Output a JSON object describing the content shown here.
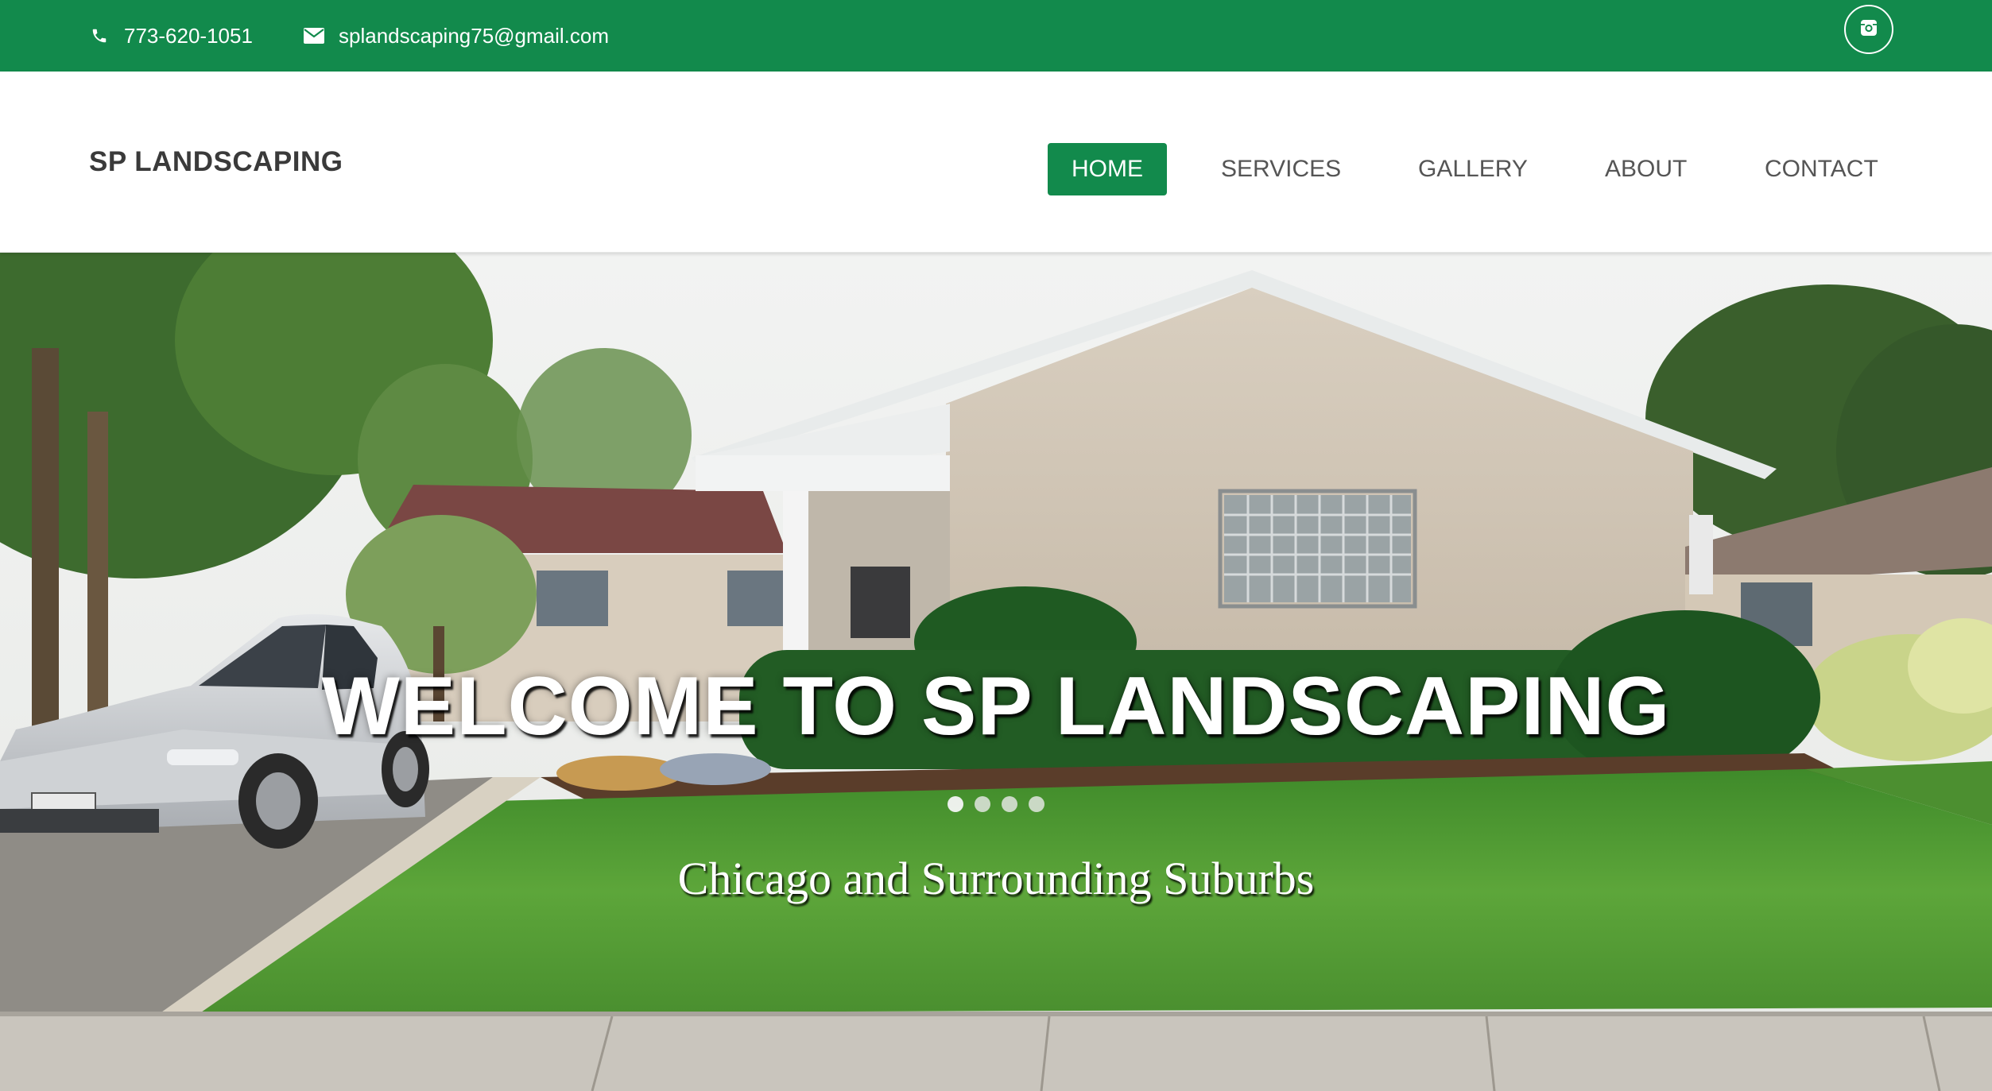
{
  "topbar": {
    "phone": "773-620-1051",
    "email": "splandscaping75@gmail.com",
    "social_icon": "instagram-icon",
    "background_color": "#128a4c"
  },
  "header": {
    "brand": "SP LANDSCAPING",
    "nav": [
      {
        "label": "HOME",
        "active": true
      },
      {
        "label": "SERVICES",
        "active": false
      },
      {
        "label": "GALLERY",
        "active": false
      },
      {
        "label": "ABOUT",
        "active": false
      },
      {
        "label": "CONTACT",
        "active": false
      }
    ],
    "accent_color": "#128a4c"
  },
  "hero": {
    "title": "WELCOME TO SP LANDSCAPING",
    "subtitle": "Chicago and Surrounding Suburbs",
    "slide_count": 4,
    "active_slide": 1
  }
}
